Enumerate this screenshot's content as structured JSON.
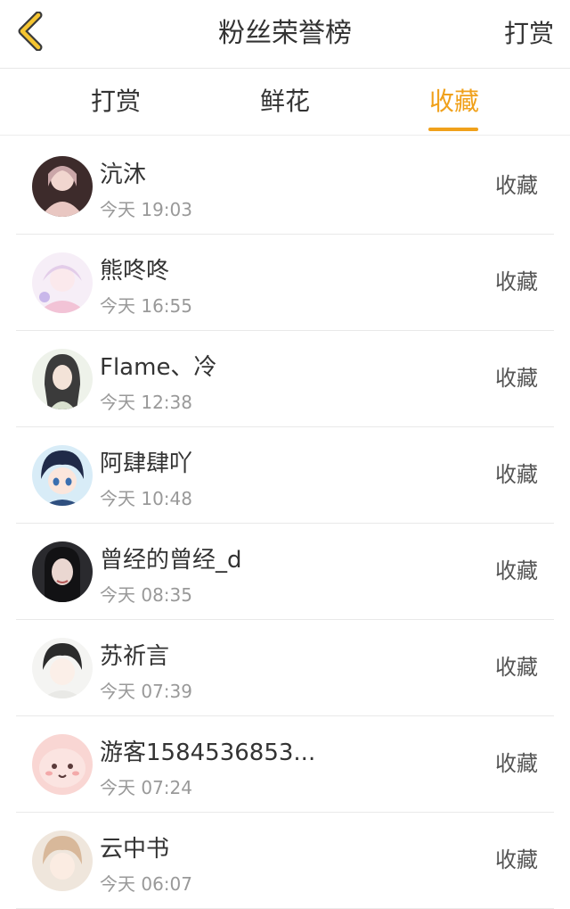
{
  "header": {
    "title": "粉丝荣誉榜",
    "right_action": "打赏",
    "accent_color": "#f0a11b"
  },
  "tabs": [
    {
      "label": "打赏",
      "active": false
    },
    {
      "label": "鲜花",
      "active": false
    },
    {
      "label": "收藏",
      "active": true
    }
  ],
  "fans": [
    {
      "name": "沆沐",
      "time": "今天 19:03",
      "action": "收藏",
      "avatar": "avatar-image"
    },
    {
      "name": "熊咚咚",
      "time": "今天 16:55",
      "action": "收藏",
      "avatar": "avatar-image"
    },
    {
      "name": "Flame、冷",
      "time": "今天 12:38",
      "action": "收藏",
      "avatar": "avatar-image"
    },
    {
      "name": "阿肆肆吖",
      "time": "今天 10:48",
      "action": "收藏",
      "avatar": "avatar-image"
    },
    {
      "name": "曾经的曾经_d",
      "time": "今天 08:35",
      "action": "收藏",
      "avatar": "avatar-image"
    },
    {
      "name": "苏祈言",
      "time": "今天 07:39",
      "action": "收藏",
      "avatar": "avatar-image"
    },
    {
      "name": "游客1584536853...",
      "time": "今天 07:24",
      "action": "收藏",
      "avatar": "avatar-image"
    },
    {
      "name": "云中书",
      "time": "今天 06:07",
      "action": "收藏",
      "avatar": "avatar-image"
    }
  ]
}
